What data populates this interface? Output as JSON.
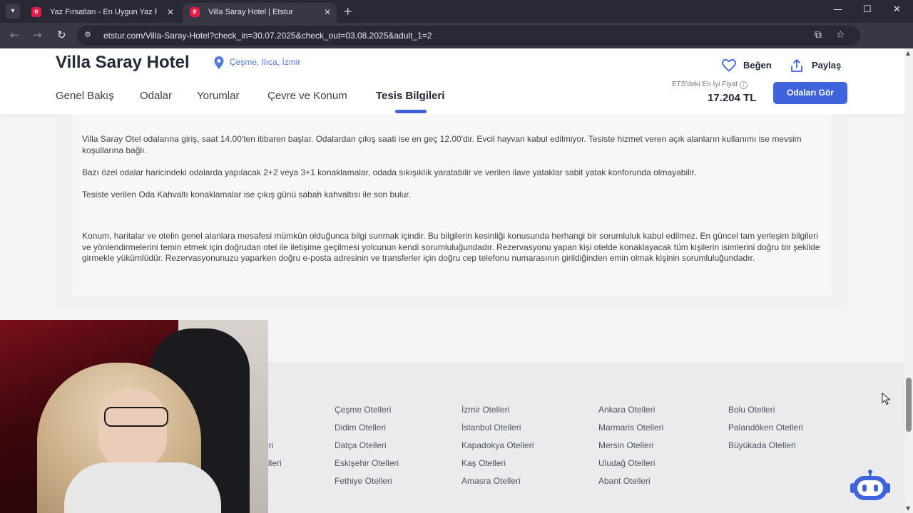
{
  "browser": {
    "tabs": [
      {
        "title": "Yaz Fırsatları - En Uygun Yaz Fır",
        "active": false
      },
      {
        "title": "Villa Saray Hotel | Etstur",
        "active": true
      }
    ],
    "url": "etstur.com/Villa-Saray-Hotel?check_in=30.07.2025&check_out=03.08.2025&adult_1=2",
    "favicon_letter": "e"
  },
  "header": {
    "hotel_name": "Villa Saray Hotel",
    "location": "Çeşme, Ilıca, İzmir",
    "like_label": "Beğen",
    "share_label": "Paylaş",
    "best_price_label": "ETS'deki En İyi Fiyat",
    "price": "17.204 TL",
    "cta_label": "Odaları Gör",
    "tabs": [
      "Genel Bakış",
      "Odalar",
      "Yorumlar",
      "Çevre ve Konum",
      "Tesis Bilgileri"
    ],
    "active_tab": "Tesis Bilgileri"
  },
  "content": {
    "paragraphs": [
      "Villa Saray Otel odalarına giriş, saat 14.00'ten itibaren başlar. Odalardan çıkış saati ise en geç 12.00'dir. Evcil hayvan kabul edilmiyor. Tesiste hizmet veren açık alanların kullanımı ise mevsim koşullarına bağlı.",
      "Bazı özel odalar haricindeki odalarda yapılacak 2+2 veya 3+1 konaklamalar, odada sıkışıklık yaratabilir ve verilen ilave yataklar sabit yatak konforunda olmayabilir.",
      "Tesiste verilen Oda Kahvaltı konaklamalar ise çıkış günü sabah kahvaltısı ile son bulur.",
      "Konum, haritalar ve otelin genel alanlara mesafesi mümkün olduğunca bilgi sunmak içindir. Bu bilgilerin kesinliği konusunda herhangi bir sorumluluk kabul edilmez. En güncel tam yerleşim bilgileri ve yönlendirmelerini temin etmek için doğrudan otel ile iletişime geçilmesi yolcunun kendi sorumluluğundadır. Rezervasyonu yapan kişi otelde konaklayacak tüm kişilerin isimlerini doğru bir şekilde girmekle yükümlüdür. Rezervasyonunuzu yaparken doğru e-posta adresinin ve transferler için doğru cep telefonu numarasının girildiğinden emin olmak kişinin sorumluluğundadır."
    ]
  },
  "footer": {
    "columns": [
      {
        "links": [
          "Çeşme Otelleri",
          "Didim Otelleri",
          "Datça Otelleri",
          "Eskişehir Otelleri",
          "Fethiye Otelleri"
        ]
      },
      {
        "links": [
          "İzmir Otelleri",
          "İstanbul Otelleri",
          "Kapadokya Otelleri",
          "Kaş Otelleri",
          "Amasra Otelleri"
        ]
      },
      {
        "links": [
          "Ankara Otelleri",
          "Marmaris Otelleri",
          "Mersin Otelleri",
          "Uludağ Otelleri",
          "Abant Otelleri"
        ]
      },
      {
        "links": [
          "Bolu Otelleri",
          "Palandöken Otelleri",
          "Büyükada Otelleri"
        ]
      }
    ],
    "partial_links": [
      "eri",
      "lleri"
    ]
  },
  "colors": {
    "brand_blue": "#3e63dd",
    "location_blue": "#4f7de0",
    "favicon_red": "#e11d48"
  },
  "icons": [
    "chevron-down-icon",
    "close-icon",
    "plus-icon",
    "minimize-icon",
    "maximize-icon",
    "back-arrow-icon",
    "forward-arrow-icon",
    "reload-icon",
    "site-settings-icon",
    "cast-icon",
    "star-icon",
    "kebab-menu-icon",
    "location-pin-icon",
    "heart-icon",
    "share-icon",
    "info-icon",
    "chatbot-icon",
    "mouse-cursor-icon"
  ]
}
